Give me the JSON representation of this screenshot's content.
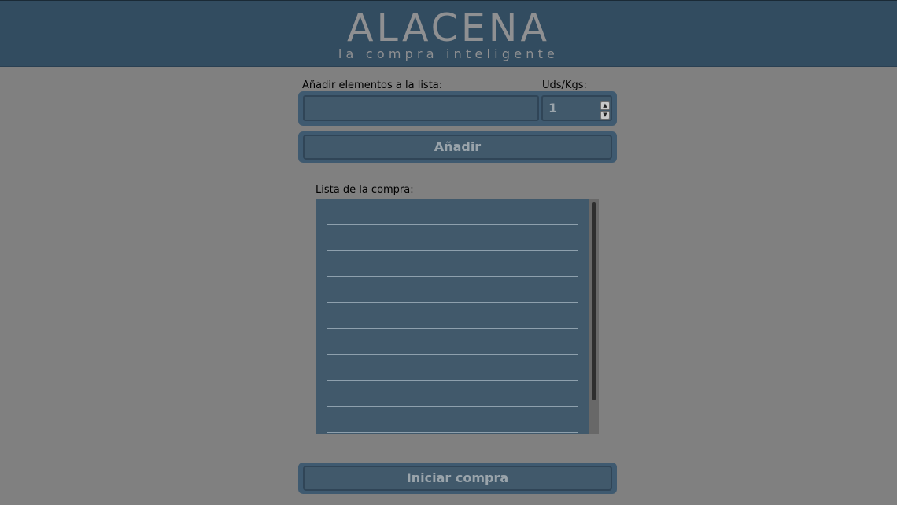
{
  "header": {
    "title": "ALACENA",
    "subtitle": "la compra inteligente"
  },
  "add_form": {
    "item_label": "Añadir elementos a la lista:",
    "item_value": "",
    "qty_label": "Uds/Kgs:",
    "qty_value": "1",
    "add_button": "Añadir"
  },
  "shopping_list": {
    "label": "Lista de la compra:",
    "items": [
      "",
      "",
      "",
      "",
      "",
      "",
      "",
      "",
      ""
    ]
  },
  "start_button": "Iniciar compra",
  "colors": {
    "header_bg": "#324c60",
    "page_bg": "#808080",
    "panel_bg": "#41596b",
    "text_muted": "#9aa4ab"
  }
}
